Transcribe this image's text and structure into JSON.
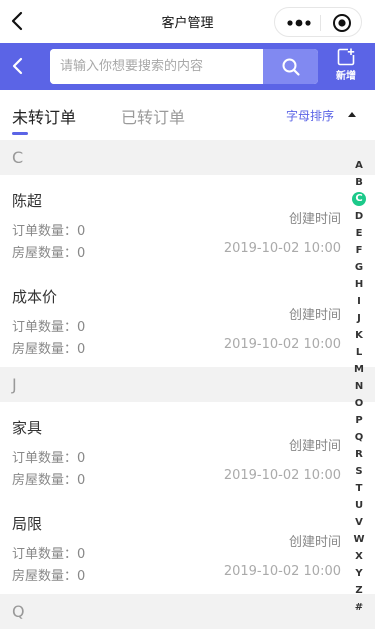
{
  "nav": {
    "title": "客户管理",
    "back_icon": "back-arrow-icon",
    "more_icon": "more-dots-icon",
    "target_icon": "target-icon"
  },
  "search": {
    "placeholder": "请输入你想要搜索的内容",
    "value": "",
    "button_icon": "search-icon",
    "add_label": "新增",
    "add_icon": "add-icon",
    "accent": "#5b64e6"
  },
  "tabs": [
    {
      "label": "未转订单",
      "active": true
    },
    {
      "label": "已转订单",
      "active": false
    }
  ],
  "sort": {
    "label": "字母排序"
  },
  "groups": [
    {
      "letter": "C",
      "items": [
        {
          "name": "陈超",
          "orders": "订单数量：0",
          "houses": "房屋数量：0",
          "created_label": "创建时间",
          "created_value": "2019-10-02 10:00"
        },
        {
          "name": "成本价",
          "orders": "订单数量：0",
          "houses": "房屋数量：0",
          "created_label": "创建时间",
          "created_value": "2019-10-02 10:00"
        }
      ]
    },
    {
      "letter": "J",
      "items": [
        {
          "name": "家具",
          "orders": "订单数量：0",
          "houses": "房屋数量：0",
          "created_label": "创建时间",
          "created_value": "2019-10-02 10:00"
        },
        {
          "name": "局限",
          "orders": "订单数量：0",
          "houses": "房屋数量：0",
          "created_label": "创建时间",
          "created_value": "2019-10-02 10:00"
        }
      ]
    },
    {
      "letter": "Q",
      "items": []
    }
  ],
  "index": {
    "letters": [
      "A",
      "B",
      "C",
      "D",
      "E",
      "F",
      "G",
      "H",
      "I",
      "J",
      "K",
      "L",
      "M",
      "N",
      "O",
      "P",
      "Q",
      "R",
      "S",
      "T",
      "U",
      "V",
      "W",
      "X",
      "Y",
      "Z",
      "#"
    ],
    "active": "C",
    "active_color": "#1cc98a"
  }
}
